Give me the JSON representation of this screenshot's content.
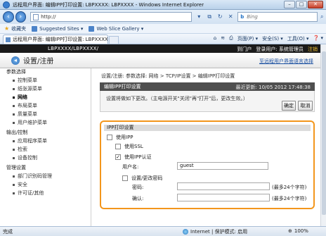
{
  "browser": {
    "window_title": "远程用户界面: 编辑IPP打印设置: LBPXXXX: LBPXXXX - Windows Internet Explorer",
    "address": "http://",
    "search_placeholder": "Bing",
    "search_brand": "b",
    "favorites_label": "收藏夹",
    "suggested_sites": "Suggested Sites ▾",
    "web_slice_gallery": "Web Slice Gallery ▾",
    "tab_title": "远程用户界面: 编辑IPP打印设置: LBPXXXX: LBP...",
    "commands": [
      "页面(P) ▾",
      "安全(S) ▾",
      "工具(O) ▾",
      "❓ ▾"
    ],
    "status_done": "完成",
    "status_zone": "Internet | 保护模式: 启用",
    "zoom": "100%"
  },
  "page": {
    "model": "LBPXXXX/LBPXXXX/",
    "portal_link": "到门户",
    "login_user": "登录用户: 系统管理员",
    "logout": "注销",
    "section_title": "设置/注册",
    "language_link": "至远程用户界面语言选择",
    "breadcrumb": "设置/注册: 参数选择: 网络 > TCP/IP设置 > 编辑IPP打印设置"
  },
  "sidebar": {
    "groups": [
      {
        "label": "参数选择",
        "items": [
          {
            "label": "控制菜单",
            "active": false
          },
          {
            "label": "纸张源菜单",
            "active": false
          },
          {
            "label": "网络",
            "active": true
          },
          {
            "label": "布局菜单",
            "active": false
          },
          {
            "label": "质量菜单",
            "active": false
          },
          {
            "label": "用户维护菜单",
            "active": false
          }
        ]
      },
      {
        "label": "输出/控制",
        "items": [
          {
            "label": "应用程序菜单",
            "active": false
          },
          {
            "label": "检索",
            "active": false
          },
          {
            "label": "设备控制",
            "active": false
          }
        ]
      },
      {
        "label": "管理设置",
        "items": [
          {
            "label": "部门识别码管理",
            "active": false
          },
          {
            "label": "安全",
            "active": false
          },
          {
            "label": "许可证/其他",
            "active": false
          }
        ]
      }
    ]
  },
  "panel": {
    "title": "编辑IPP打印设置",
    "last_updated": "最近更新: 10/05 2012 17:48:38",
    "note": "设置将做如下更改。（主电源开关\"关闭\"再\"打开\"后，更改生效。）",
    "ok_label": "确定",
    "cancel_label": "取消"
  },
  "ipp": {
    "section_label": "IPP打印设置",
    "use_ipp": {
      "label": "使用IPP",
      "checked": false
    },
    "use_ssl": {
      "label": "使用SSL",
      "checked": false
    },
    "use_auth": {
      "label": "使用IPP认证",
      "checked": true
    },
    "username_label": "用户名:",
    "username_value": "guest",
    "set_password": {
      "label": "设置/更改密码",
      "checked": false
    },
    "password_label": "密码:",
    "password_value": "",
    "password_hint": "(最多24个字符)",
    "confirm_label": "确认:",
    "confirm_value": "",
    "confirm_hint": "(最多24个字符)"
  }
}
